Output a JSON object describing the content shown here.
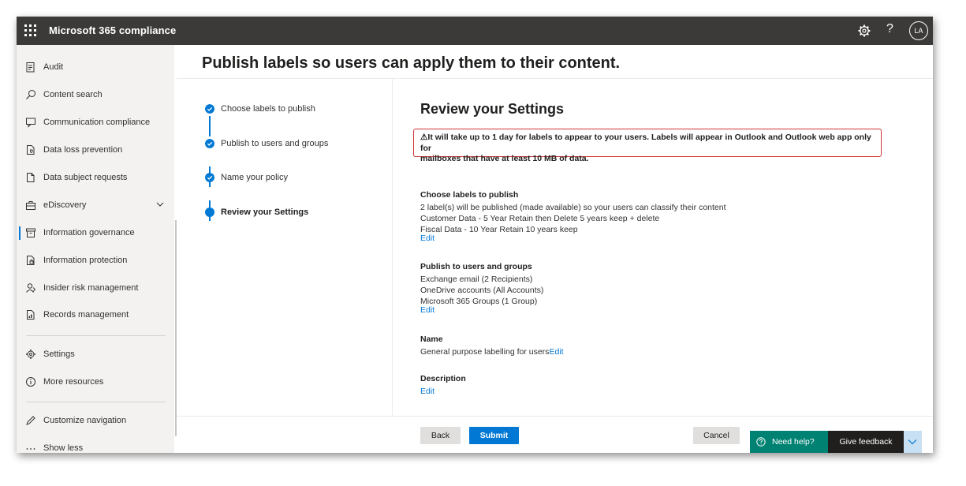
{
  "app": {
    "title": "Microsoft 365 compliance",
    "avatar_initials": "LA",
    "help_glyph": "?"
  },
  "sidebar": {
    "items": [
      {
        "label": "Audit",
        "icon": "clipboard-icon"
      },
      {
        "label": "Content search",
        "icon": "search-icon"
      },
      {
        "label": "Communication compliance",
        "icon": "chat-icon"
      },
      {
        "label": "Data loss prevention",
        "icon": "document-shield-icon"
      },
      {
        "label": "Data subject requests",
        "icon": "document-icon"
      },
      {
        "label": "eDiscovery",
        "icon": "briefcase-icon"
      },
      {
        "label": "Information governance",
        "icon": "archive-icon"
      },
      {
        "label": "Information protection",
        "icon": "lock-document-icon"
      },
      {
        "label": "Insider risk management",
        "icon": "person-icon"
      },
      {
        "label": "Records management",
        "icon": "document-chart-icon"
      }
    ],
    "settings_label": "Settings",
    "more_resources_label": "More resources",
    "customize_label": "Customize navigation",
    "show_less_label": "Show less",
    "active_item": "Information governance"
  },
  "page": {
    "title": "Publish labels so users can apply them to their content."
  },
  "steps": [
    {
      "label": "Choose labels to publish",
      "state": "done"
    },
    {
      "label": "Publish to users and groups",
      "state": "done"
    },
    {
      "label": "Name your policy",
      "state": "done"
    },
    {
      "label": "Review your Settings",
      "state": "current"
    }
  ],
  "review": {
    "title": "Review your Settings",
    "warning_icon": "⚠",
    "warning_line1": "It will take up to 1 day for labels to appear to your users. Labels will appear in Outlook and Outlook web app only for",
    "warning_line2": "mailboxes that have at least 10 MB of data.",
    "edit_label": "Edit",
    "labels_section": {
      "heading": "Choose labels to publish",
      "lines": [
        "2 label(s) will be published (made available) so your users can classify their content",
        "Customer Data - 5 Year Retain then Delete 5 years keep + delete",
        "Fiscal Data - 10 Year Retain 10 years keep"
      ]
    },
    "publish_section": {
      "heading": "Publish to users and groups",
      "lines": [
        "Exchange email (2 Recipients)",
        "OneDrive accounts (All Accounts)",
        "Microsoft 365 Groups (1 Group)"
      ]
    },
    "name_section": {
      "heading": "Name",
      "value": "General purpose labelling for users"
    },
    "description_section": {
      "heading": "Description"
    }
  },
  "footer": {
    "back_label": "Back",
    "submit_label": "Submit",
    "cancel_label": "Cancel",
    "need_help_label": "Need help?",
    "feedback_label": "Give feedback"
  },
  "colors": {
    "accent": "#0078d4",
    "topbar": "#3b3a39",
    "warning_border": "#d13438",
    "help_green": "#008272"
  }
}
